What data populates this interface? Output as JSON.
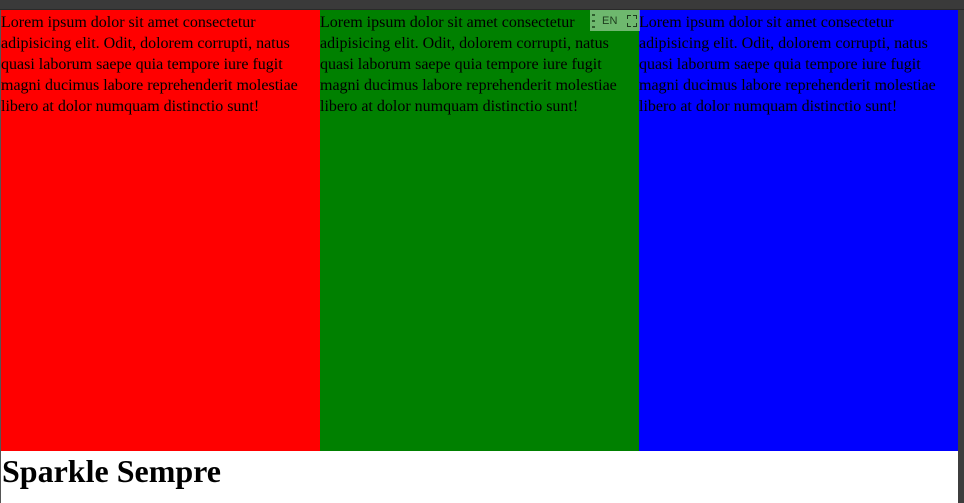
{
  "columns": [
    {
      "id": "red",
      "color": "#ff0000",
      "text": "Lorem ipsum dolor sit amet consectetur adipisicing elit. Odit, dolorem corrupti, natus quasi laborum saepe quia tempore iure fugit magni ducimus labore reprehenderit molestiae libero at dolor numquam distinctio sunt!"
    },
    {
      "id": "green",
      "color": "#008000",
      "text": "Lorem ipsum dolor sit amet consectetur adipisicing elit. Odit, dolorem corrupti, natus quasi laborum saepe quia tempore iure fugit magni ducimus labore reprehenderit molestiae libero at dolor numquam distinctio sunt!"
    },
    {
      "id": "blue",
      "color": "#0000ff",
      "text": "Lorem ipsum dolor sit amet consectetur adipisicing elit. Odit, dolorem corrupti, natus quasi laborum saepe quia tempore iure fugit magni ducimus labore reprehenderit molestiae libero at dolor numquam distinctio sunt!"
    }
  ],
  "heading": "Sparkle Sempre",
  "language_widget": {
    "label": "EN",
    "icons": [
      "drag-grip-icon",
      "expand-icon"
    ]
  }
}
